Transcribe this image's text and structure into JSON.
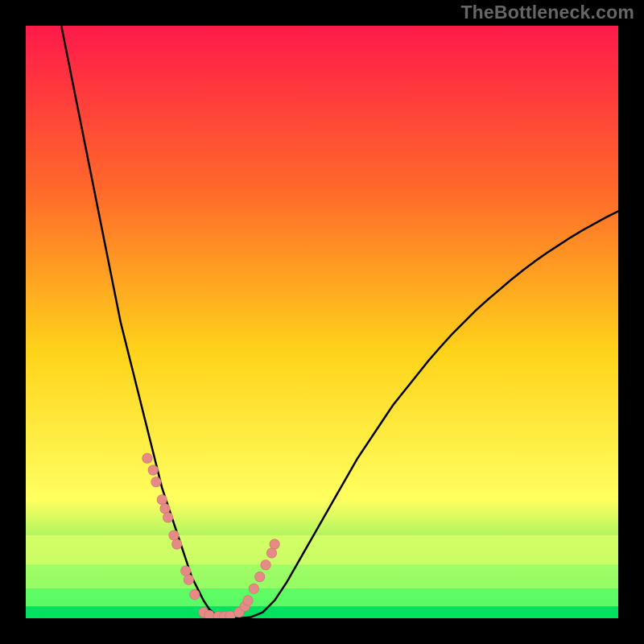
{
  "watermark": "TheBottleneck.com",
  "colors": {
    "gradient_top": "#ff1a4a",
    "gradient_mid1": "#ff6a2a",
    "gradient_mid2": "#ffd31a",
    "gradient_mid3": "#ffff60",
    "gradient_bottom": "#00e060",
    "curve": "#000000",
    "marker_fill": "#e58a86",
    "marker_stroke": "#c97470",
    "band1": "#d9ff66",
    "band2": "#a6ff66",
    "band3": "#66ff66",
    "band4": "#00e060"
  },
  "chart_data": {
    "type": "line",
    "title": "",
    "xlabel": "",
    "ylabel": "",
    "xlim": [
      0,
      100
    ],
    "ylim": [
      0,
      100
    ],
    "grid": false,
    "legend": false,
    "series": [
      {
        "name": "curve",
        "x": [
          6,
          7,
          8,
          9,
          10,
          11,
          12,
          13,
          14,
          15,
          16,
          17,
          18,
          19,
          20,
          21,
          22,
          23,
          24,
          25,
          26,
          27,
          28,
          29,
          30,
          31,
          32,
          33,
          34,
          36,
          38,
          40,
          42,
          44,
          46,
          48,
          50,
          52,
          54,
          56,
          58,
          60,
          62,
          64,
          66,
          68,
          70,
          72,
          74,
          76,
          78,
          80,
          82,
          84,
          86,
          88,
          90,
          92,
          94,
          96,
          98,
          100
        ],
        "y": [
          100,
          95,
          90,
          85,
          80,
          75,
          70,
          65,
          60,
          55,
          50,
          46,
          42,
          38,
          34,
          30,
          26,
          22,
          19,
          16,
          13,
          10,
          7,
          5,
          3,
          1.5,
          0.6,
          0.2,
          0,
          0,
          0.2,
          1,
          3,
          6,
          9.5,
          13,
          16.5,
          20,
          23.5,
          27,
          30,
          33,
          36,
          38.5,
          41,
          43.5,
          45.8,
          48,
          50,
          52,
          53.8,
          55.5,
          57.2,
          58.8,
          60.3,
          61.7,
          63,
          64.3,
          65.5,
          66.6,
          67.7,
          68.7
        ]
      }
    ],
    "markers": {
      "name": "highlighted-points",
      "x": [
        20.5,
        21.5,
        22,
        23,
        23.5,
        24,
        25,
        25.5,
        27,
        27.5,
        28.5,
        30,
        31,
        32.5,
        33.5,
        34.5,
        36,
        37,
        37.5,
        38.5,
        39.5,
        40.5,
        41.5,
        42
      ],
      "y": [
        27,
        25,
        23,
        20,
        18.5,
        17,
        14,
        12.5,
        8,
        6.5,
        4,
        1,
        0.5,
        0.3,
        0.3,
        0.4,
        1,
        2,
        3,
        5,
        7,
        9,
        11,
        12.5
      ]
    },
    "y_bands": [
      {
        "from": 9,
        "to": 14,
        "color_key": "band1"
      },
      {
        "from": 5,
        "to": 9,
        "color_key": "band2"
      },
      {
        "from": 2,
        "to": 5,
        "color_key": "band3"
      },
      {
        "from": 0,
        "to": 2,
        "color_key": "band4"
      }
    ]
  }
}
